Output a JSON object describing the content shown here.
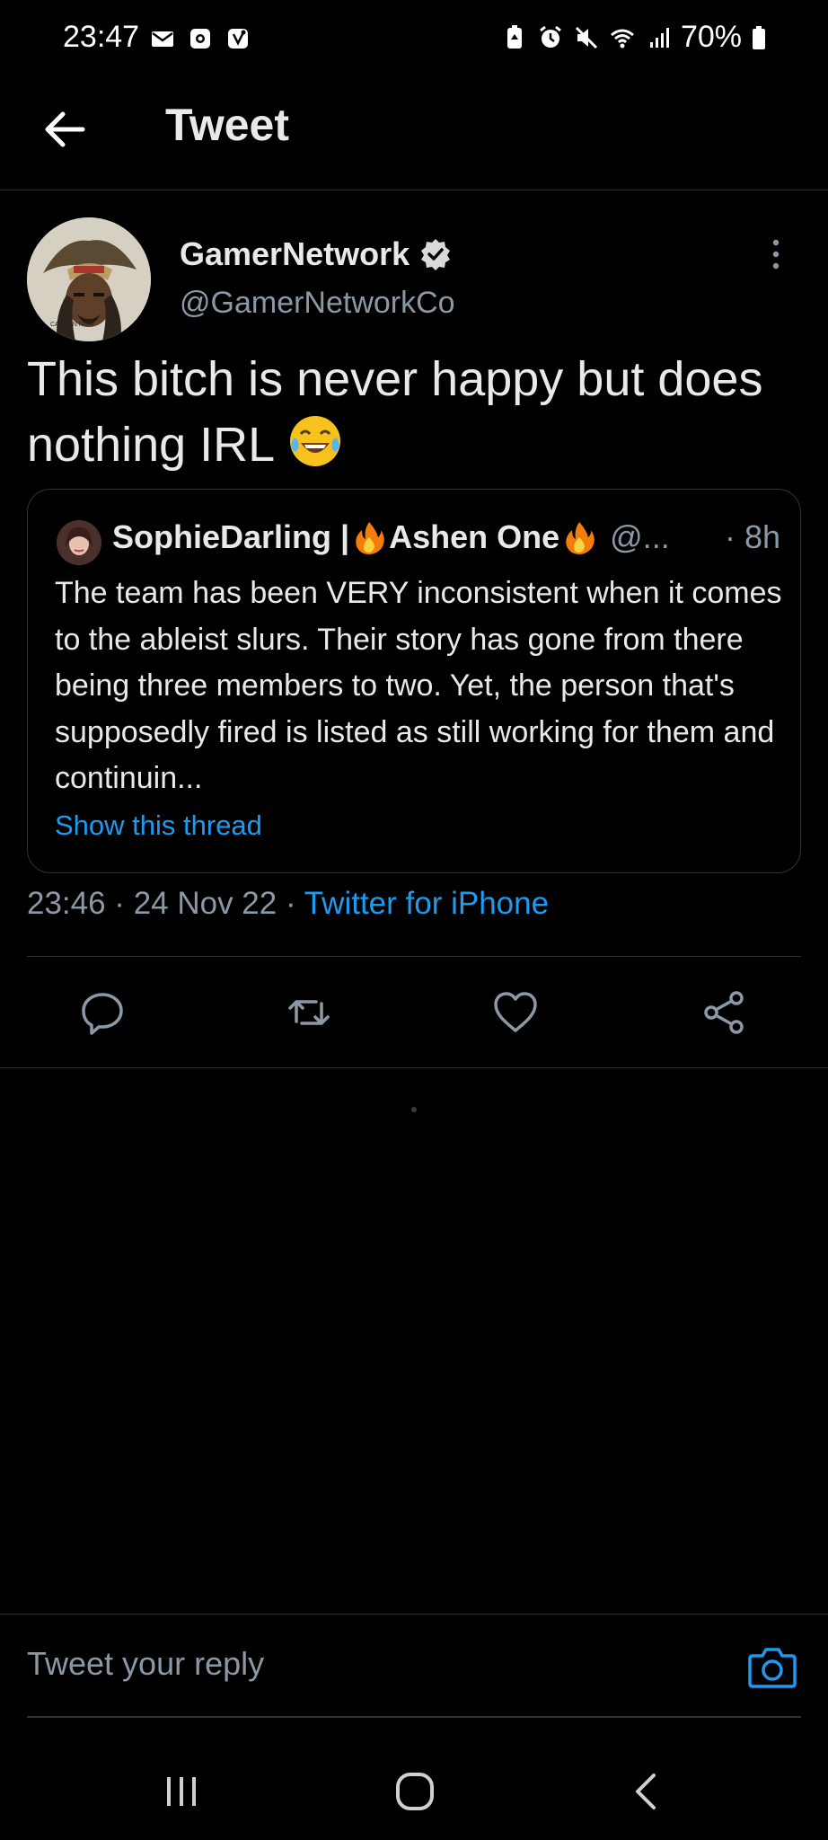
{
  "status_bar": {
    "time": "23:47",
    "battery_percent": "70%",
    "left_icons": [
      "mail-icon",
      "notification-icon",
      "app-notification-icon"
    ],
    "right_icons": [
      "battery-saver-icon",
      "alarm-icon",
      "mute-icon",
      "wifi-icon",
      "signal-icon",
      "battery-icon"
    ]
  },
  "header": {
    "title": "Tweet",
    "back_icon": "arrow-left-icon"
  },
  "tweet": {
    "author_name": "GamerNetwork",
    "author_handle": "@GamerNetworkCo",
    "verified": true,
    "text": "This bitch is never happy but does nothing IRL",
    "emoji": "😂",
    "timestamp": "23:46 · 24 Nov 22 · ",
    "source": "Twitter for iPhone"
  },
  "quoted_tweet": {
    "name_part1": "SophieDarling | ",
    "name_part2": "Ashen One",
    "handle": "@...",
    "time": "· 8h",
    "body": "The team has been VERY inconsistent when it comes to the ableist slurs. Their story has gone from there being three members to two. Yet, the person that's supposedly fired is listed as still working for them and continuin...",
    "show_thread": "Show this thread"
  },
  "actions": [
    "reply-icon",
    "retweet-icon",
    "like-icon",
    "share-icon"
  ],
  "reply": {
    "placeholder": "Tweet your reply"
  },
  "colors": {
    "background": "#000000",
    "accent": "#1d9bf0",
    "text": "#e7e9ea",
    "secondary": "#8b98a5",
    "divider": "#2f3336"
  }
}
